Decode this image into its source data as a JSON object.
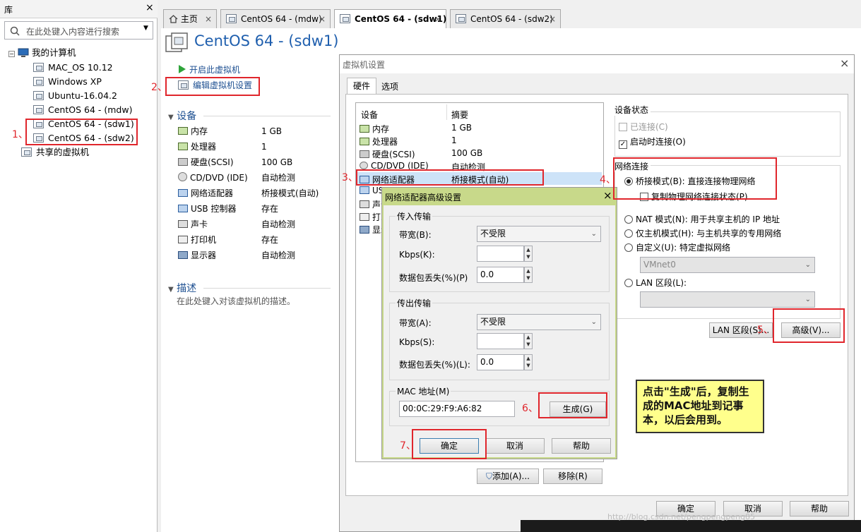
{
  "library": {
    "title": "库",
    "close": "×",
    "search_placeholder": "在此处键入内容进行搜索",
    "tree_root": "我的计算机",
    "vms": [
      "MAC_OS 10.12",
      "Windows XP",
      "Ubuntu-16.04.2",
      "CentOS 64 - (mdw)",
      "CentOS 64 - (sdw1)",
      "CentOS 64 - (sdw2)"
    ],
    "shared": "共享的虚拟机"
  },
  "tabs": [
    {
      "label": "主页"
    },
    {
      "label": "CentOS 64 - (mdw)"
    },
    {
      "label": "CentOS 64 - (sdw1)"
    },
    {
      "label": "CentOS 64 - (sdw2)"
    }
  ],
  "tab_close": "×",
  "vm": {
    "title": "CentOS 64 - (sdw1)",
    "start": "开启此虚拟机",
    "edit": "编辑虚拟机设置",
    "devices_header": "设备",
    "devices": [
      {
        "name": "内存",
        "value": "1 GB"
      },
      {
        "name": "处理器",
        "value": "1"
      },
      {
        "name": "硬盘(SCSI)",
        "value": "100 GB"
      },
      {
        "name": "CD/DVD (IDE)",
        "value": "自动检测"
      },
      {
        "name": "网络适配器",
        "value": "桥接模式(自动)"
      },
      {
        "name": "USB 控制器",
        "value": "存在"
      },
      {
        "name": "声卡",
        "value": "自动检测"
      },
      {
        "name": "打印机",
        "value": "存在"
      },
      {
        "name": "显示器",
        "value": "自动检测"
      }
    ],
    "desc_header": "描述",
    "desc_text": "在此处键入对该虚拟机的描述。"
  },
  "settings": {
    "title": "虚拟机设置",
    "close": "×",
    "tab_hw": "硬件",
    "tab_opt": "选项",
    "col_device": "设备",
    "col_summary": "摘要",
    "rows": [
      {
        "name": "内存",
        "value": "1 GB"
      },
      {
        "name": "处理器",
        "value": "1"
      },
      {
        "name": "硬盘(SCSI)",
        "value": "100 GB"
      },
      {
        "name": "CD/DVD (IDE)",
        "value": "自动检测"
      },
      {
        "name": "网络适配器",
        "value": "桥接模式(自动)"
      },
      {
        "name": "USB",
        "value": ""
      },
      {
        "name": "声卡",
        "value": ""
      },
      {
        "name": "打印",
        "value": ""
      },
      {
        "name": "显示",
        "value": ""
      }
    ],
    "device_status": "设备状态",
    "connected": "已连接(C)",
    "connect_on_start": "启动时连接(O)",
    "net_conn": "网络连接",
    "bridged": "桥接模式(B): 直接连接物理网络",
    "replicate": "复制物理网络连接状态(P)",
    "nat": "NAT 模式(N): 用于共享主机的 IP 地址",
    "hostonly": "仅主机模式(H): 与主机共享的专用网络",
    "custom": "自定义(U): 特定虚拟网络",
    "vmnet": "VMnet0",
    "lan": "LAN 区段(L):",
    "lan_btn": "LAN 区段(S)...",
    "advanced_btn": "高级(V)...",
    "add_btn": "添加(A)...",
    "remove_btn": "移除(R)",
    "ok": "确定",
    "cancel": "取消",
    "help": "帮助"
  },
  "advanced": {
    "title": "网络适配器高级设置",
    "close": "×",
    "incoming": "传入传输",
    "outgoing": "传出传输",
    "bandwidth": "带宽(B):",
    "bandwidth_out": "带宽(A):",
    "unlimited": "不受限",
    "kbps": "Kbps(K):",
    "kbps_out": "Kbps(S):",
    "loss": "数据包丢失(%)(P)",
    "loss_out": "数据包丢失(%)(L):",
    "loss_value": "0.0",
    "loss_value_out": "0.0",
    "mac_label": "MAC 地址(M)",
    "mac_value": "00:0C:29:F9:A6:82",
    "generate": "生成(G)",
    "ok": "确定",
    "cancel": "取消",
    "help": "帮助"
  },
  "annotations": {
    "n1": "1、",
    "n2": "2、",
    "n3": "3、",
    "n4": "4、",
    "n5": "5、",
    "n6": "6、",
    "n7": "7、",
    "note": "点击\"生成\"后，复制生成的MAC地址到记事本，以后会用到。"
  },
  "watermark": "http://blog.csdn.net/pengpengpeng85"
}
